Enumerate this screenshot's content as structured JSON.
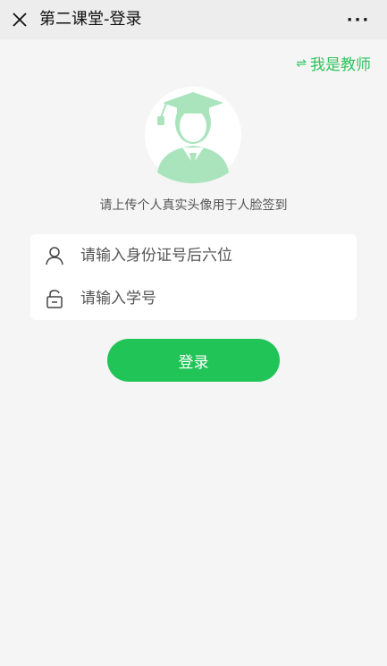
{
  "header": {
    "title": "第二课堂-登录",
    "more_label": "···"
  },
  "switch_role": {
    "arrows": "⇌",
    "label": "我是教师"
  },
  "hint": "请上传个人真实头像用于人脸签到",
  "form": {
    "id_placeholder": "请输入身份证号后六位",
    "student_no_placeholder": "请输入学号"
  },
  "login_label": "登录",
  "colors": {
    "accent": "#21c457",
    "link": "#2fc45d",
    "avatar": "#a9e4bd",
    "background": "#f5f5f5"
  }
}
